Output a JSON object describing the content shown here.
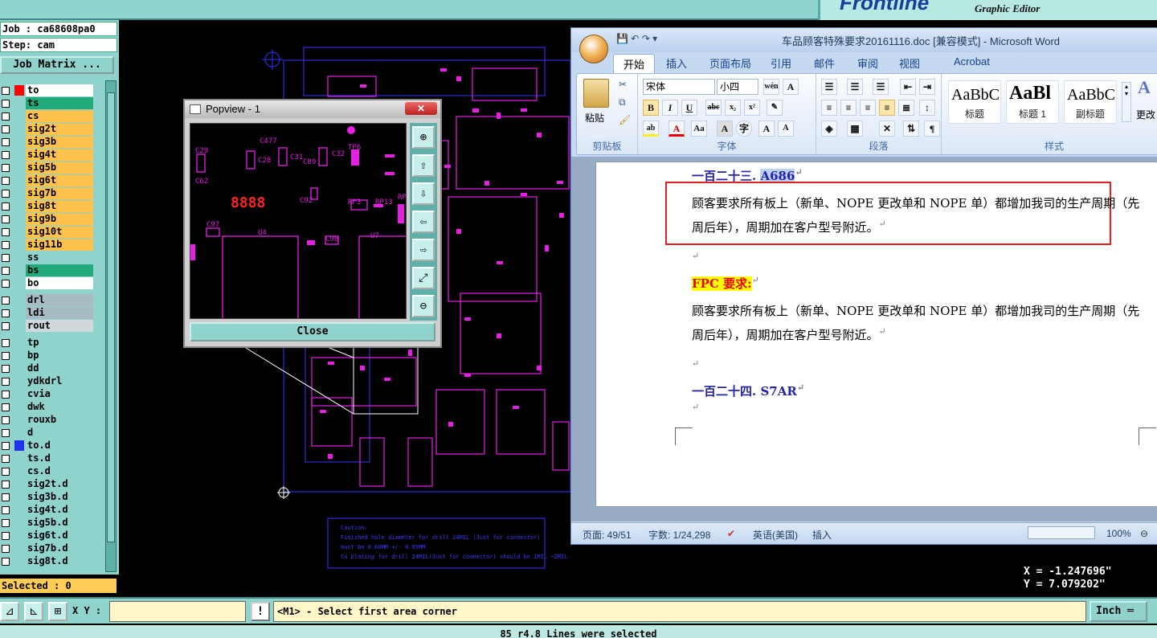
{
  "frontline": {
    "logo": "Frontline",
    "subtitle": "Graphic Editor"
  },
  "job": {
    "job_label": "Job : ca68608pa0",
    "step_label": "Step: cam",
    "matrix_button": "Job Matrix ..."
  },
  "layers": [
    {
      "name": "to",
      "color": "#ffffff",
      "pen": true,
      "act": "#ff0000"
    },
    {
      "name": "ts",
      "color": "#22aa7a",
      "pen": true,
      "act": ""
    },
    {
      "name": "cs",
      "color": "#ffc34d",
      "pen": true,
      "act": ""
    },
    {
      "name": "sig2t",
      "color": "#ffc34d",
      "pen": true,
      "act": ""
    },
    {
      "name": "sig3b",
      "color": "#ffc34d",
      "pen": true,
      "act": ""
    },
    {
      "name": "sig4t",
      "color": "#ffc34d",
      "pen": true,
      "act": ""
    },
    {
      "name": "sig5b",
      "color": "#ffc34d",
      "pen": true,
      "act": ""
    },
    {
      "name": "sig6t",
      "color": "#ffc34d",
      "pen": true,
      "act": ""
    },
    {
      "name": "sig7b",
      "color": "#ffc34d",
      "pen": true,
      "act": ""
    },
    {
      "name": "sig8t",
      "color": "#ffc34d",
      "pen": true,
      "act": ""
    },
    {
      "name": "sig9b",
      "color": "#ffc34d",
      "pen": true,
      "act": ""
    },
    {
      "name": "sig10t",
      "color": "#ffc34d",
      "pen": true,
      "act": ""
    },
    {
      "name": "sig11b",
      "color": "#ffc34d",
      "pen": true,
      "act": ""
    },
    {
      "name": "ss",
      "color": "#8fd3cc",
      "pen": true,
      "act": ""
    },
    {
      "name": "bs",
      "color": "#22aa7a",
      "pen": true,
      "act": ""
    },
    {
      "name": "bo",
      "color": "#ffffff",
      "pen": true,
      "act": ""
    },
    {
      "name": "drl",
      "color": "#a7bcc2",
      "pen": false,
      "act": "",
      "gap": true
    },
    {
      "name": "ldi",
      "color": "#a7bcc2",
      "pen": false,
      "act": ""
    },
    {
      "name": "rout",
      "color": "#cfd8da",
      "pen": false,
      "act": ""
    },
    {
      "name": "tp",
      "color": "#8fd3cc",
      "pen": true,
      "act": "",
      "gap": true
    },
    {
      "name": "bp",
      "color": "#8fd3cc",
      "pen": true,
      "act": ""
    },
    {
      "name": "dd",
      "color": "#8fd3cc",
      "pen": true,
      "act": ""
    },
    {
      "name": "ydkdrl",
      "color": "#8fd3cc",
      "pen": false,
      "act": ""
    },
    {
      "name": "cvia",
      "color": "#8fd3cc",
      "pen": false,
      "act": ""
    },
    {
      "name": "dwk",
      "color": "#8fd3cc",
      "pen": false,
      "act": ""
    },
    {
      "name": "rouxb",
      "color": "#8fd3cc",
      "pen": false,
      "act": ""
    },
    {
      "name": "d",
      "color": "#8fd3cc",
      "pen": false,
      "act": ""
    },
    {
      "name": "to.d",
      "color": "#8fd3cc",
      "pen": true,
      "act": "#2233ee"
    },
    {
      "name": "ts.d",
      "color": "#8fd3cc",
      "pen": true,
      "act": ""
    },
    {
      "name": "cs.d",
      "color": "#8fd3cc",
      "pen": true,
      "act": ""
    },
    {
      "name": "sig2t.d",
      "color": "#8fd3cc",
      "pen": true,
      "act": ""
    },
    {
      "name": "sig3b.d",
      "color": "#8fd3cc",
      "pen": true,
      "act": ""
    },
    {
      "name": "sig4t.d",
      "color": "#8fd3cc",
      "pen": true,
      "act": ""
    },
    {
      "name": "sig5b.d",
      "color": "#8fd3cc",
      "pen": true,
      "act": ""
    },
    {
      "name": "sig6t.d",
      "color": "#8fd3cc",
      "pen": true,
      "act": ""
    },
    {
      "name": "sig7b.d",
      "color": "#8fd3cc",
      "pen": true,
      "act": ""
    },
    {
      "name": "sig8t.d",
      "color": "#8fd3cc",
      "pen": true,
      "act": ""
    }
  ],
  "selected_label": "Selected : 0",
  "popview": {
    "title": "Popview - 1",
    "close_button": "Close",
    "labels": [
      "C477",
      "TP6",
      "C32",
      "C28",
      "C31",
      "C89",
      "C62",
      "C29",
      "C92",
      "RP3",
      "RP13",
      "RP4",
      "C97",
      "U4",
      "C98",
      "U7"
    ],
    "led": "8888",
    "tools": [
      "zoom-in-icon",
      "pan-up-icon",
      "pan-down-icon",
      "pan-left-icon",
      "pan-right-icon",
      "fit-icon",
      "zoom-out-icon"
    ]
  },
  "canvas_note": [
    "Caution:",
    "Finished hole diameter for drill 24MIL (Just for connector)",
    "must be 0.60MM +/- 0.05MM",
    "Cu plating for drill 24MIL(Just for connector) should be 1MIL ~2MIL"
  ],
  "word": {
    "title": "车品顾客特殊要求20161116.doc [兼容模式] - Microsoft Word",
    "tabs": [
      "开始",
      "插入",
      "页面布局",
      "引用",
      "邮件",
      "审阅",
      "视图",
      "Acrobat"
    ],
    "ribbon": {
      "paste": "粘贴",
      "font_name": "宋体",
      "font_size": "小四",
      "groups": [
        "剪贴板",
        "字体",
        "段落",
        "样式"
      ],
      "styles": [
        {
          "preview": "AaBbC",
          "name": "标题"
        },
        {
          "preview": "AaBl",
          "name": "标题 1"
        },
        {
          "preview": "AaBbC",
          "name": "副标题"
        }
      ],
      "change_styles": "更改"
    },
    "doc": {
      "heading1_prefix": "一百二十三. ",
      "heading1_code": "A686",
      "para1_line1": "顾客要求所有板上（新单、NOPE 更改单和 NOPE 单）都增加我司的生产周期（先",
      "para1_line2": "周后年），周期加在客户型号附近。",
      "fpc_heading": "FPC 要求:",
      "para2_line1": "顾客要求所有板上（新单、NOPE 更改单和 NOPE 单）都增加我司的生产周期（先",
      "para2_line2": "周后年），周期加在客户型号附近。",
      "heading2": "一百二十四. S7AR",
      "para_mark": "↵"
    },
    "status": {
      "page": "页面: 49/51",
      "words": "字数: 1/24,298",
      "lang": "英语(美国)",
      "mode": "插入",
      "zoom": "100%"
    }
  },
  "coord": {
    "x": "X = -1.247696\"",
    "y": "Y = 7.079202\""
  },
  "bottom": {
    "xy_label": "X Y :",
    "xy_value": "",
    "prompt": "<M1> - Select first area corner",
    "unit": "Inch",
    "message": "85 r4.8 Lines were selected"
  }
}
